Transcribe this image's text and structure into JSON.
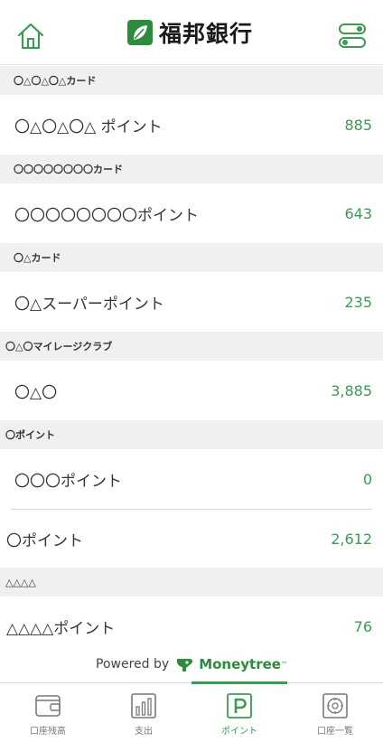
{
  "header": {
    "bank_name": "福邦銀行"
  },
  "sections": [
    {
      "title": "〇△〇△〇△カード",
      "rows": [
        {
          "name": "〇△〇△〇△ ポイント",
          "value": "885"
        }
      ]
    },
    {
      "title": "〇〇〇〇〇〇〇〇カード",
      "rows": [
        {
          "name": "〇〇〇〇〇〇〇〇ポイント",
          "value": "643"
        }
      ]
    },
    {
      "title": "〇△カード",
      "rows": [
        {
          "name": "〇△スーパーポイント",
          "value": "235"
        }
      ]
    },
    {
      "title": "〇△〇マイレージクラブ",
      "rows": [
        {
          "name": "〇△〇",
          "value": "3,885"
        }
      ]
    },
    {
      "title": "〇ポイント",
      "rows": [
        {
          "name": "〇〇〇ポイント",
          "value": "0"
        },
        {
          "name": "〇ポイント",
          "value": "2,612"
        }
      ]
    },
    {
      "title": "△△△△",
      "rows": [
        {
          "name": "△△△△ポイント",
          "value": "76"
        }
      ]
    }
  ],
  "footer": {
    "powered_by": "Powered by",
    "provider": "Moneytree",
    "provider_tm": "™"
  },
  "tabs": [
    {
      "label": "口座残高",
      "icon": "wallet-icon",
      "active": false
    },
    {
      "label": "支出",
      "icon": "bar-chart-icon",
      "active": false
    },
    {
      "label": "ポイント",
      "icon": "points-icon",
      "active": true
    },
    {
      "label": "口座一覧",
      "icon": "vault-icon",
      "active": false
    }
  ],
  "colors": {
    "accent": "#3c9a54",
    "section_bg": "#f0f0f0",
    "brand_green": "#2e8b3e"
  }
}
